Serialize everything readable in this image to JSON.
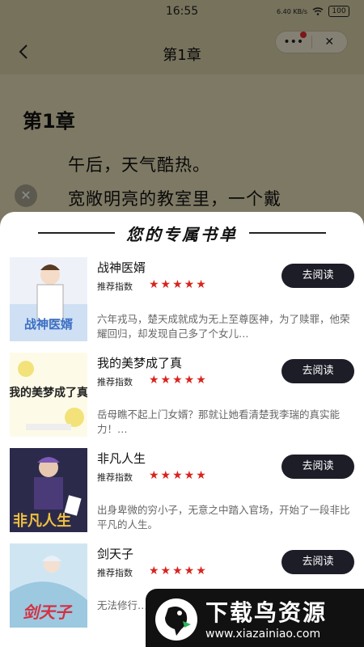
{
  "status_bar": {
    "time": "16:55",
    "net_speed": "6.40 KB/s",
    "battery": "100"
  },
  "nav": {
    "title": "第1章",
    "more_label": "•••",
    "close_label": "✕"
  },
  "reader": {
    "chapter_heading": "第1章",
    "paragraphs": [
      "午后，天气酷热。",
      "宽敞明亮的教室里，一个戴"
    ]
  },
  "sheet": {
    "title": "您的专属书单",
    "books": [
      {
        "title": "战神医婿",
        "rec_label": "推荐指数",
        "stars": "★★★★★",
        "button": "去阅读",
        "description": "六年戎马，楚天成就成为无上至尊医神，为了赎罪，他荣耀回归，却发现自己多了个女儿…",
        "cover_text": "战神医婿",
        "cover_color": "#3c6fc4"
      },
      {
        "title": "我的美梦成了真",
        "rec_label": "推荐指数",
        "stars": "★★★★★",
        "button": "去阅读",
        "description": "岳母瞧不起上门女婿？那就让她看清楚我李瑞的真实能力！…",
        "cover_text": "我的美梦成了真",
        "cover_color": "#f3e27a"
      },
      {
        "title": "非凡人生",
        "rec_label": "推荐指数",
        "stars": "★★★★★",
        "button": "去阅读",
        "description": "出身卑微的穷小子，无意之中踏入官场，开始了一段非比平凡的人生。",
        "cover_text": "非凡人生",
        "cover_color": "#2b2a4a"
      },
      {
        "title": "剑天子",
        "rec_label": "推荐指数",
        "stars": "★★★★★",
        "button": "去阅读",
        "description": "无法修行……皇城，寻……",
        "cover_text": "剑天子",
        "cover_color": "#9cc8e0"
      }
    ]
  },
  "watermark": {
    "text": "下载鸟资源",
    "url": "www.xiazainiao.com"
  },
  "colors": {
    "star": "#d8241d",
    "button_bg": "#1d1d28",
    "reader_bg": "#e6ddb6"
  }
}
